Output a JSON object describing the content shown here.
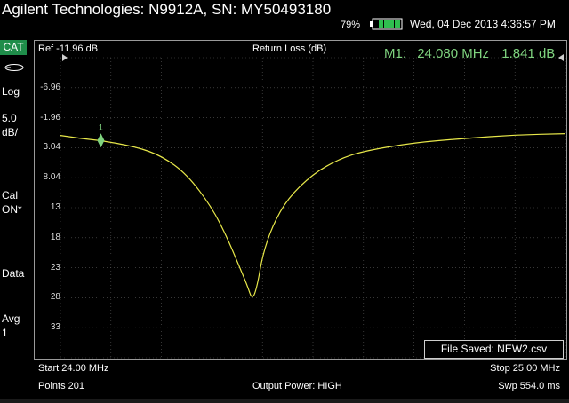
{
  "header": {
    "title": "Agilent Technologies: N9912A, SN: MY50493180",
    "battery_percent": "79%",
    "datetime": "Wed, 04 Dec 2013 4:36:57 PM"
  },
  "sidebar": {
    "mode": "CAT",
    "items": [
      {
        "label": "Log"
      },
      {
        "label": "5.0"
      },
      {
        "label": "dB/"
      },
      {
        "label": "Cal"
      },
      {
        "label": "ON*"
      },
      {
        "label": "Data"
      },
      {
        "label": "Avg"
      },
      {
        "label": "1"
      }
    ]
  },
  "plot": {
    "ref_label": "Ref -11.96 dB",
    "title": "Return Loss (dB)",
    "marker_label": "M1:",
    "marker_freq": "24.080 MHz",
    "marker_value": "1.841 dB",
    "marker_number": "1",
    "y_ticks": [
      "-6.96",
      "-1.96",
      "3.04",
      "8.04",
      "13",
      "18",
      "23",
      "28",
      "33"
    ],
    "file_status": "File Saved: NEW2.csv",
    "trace_color": "#e8e84a",
    "marker_color": "#7fd37f"
  },
  "chart_data": {
    "type": "line",
    "title": "Return Loss (dB)",
    "xlabel": "",
    "ylabel": "",
    "xlim": [
      24.0,
      25.0
    ],
    "ylim": [
      -11.96,
      38.04
    ],
    "y_inverted": true,
    "series": [
      {
        "x": [
          24.0,
          24.05,
          24.08,
          24.15,
          24.2,
          24.25,
          24.3,
          24.33,
          24.35,
          24.37,
          24.38,
          24.39,
          24.4,
          24.42,
          24.45,
          24.5,
          24.55,
          24.6,
          24.7,
          24.8,
          24.9,
          25.0
        ],
        "values": [
          1.0,
          1.6,
          1.841,
          2.9,
          4.4,
          7.4,
          13.0,
          18.0,
          22.0,
          26.0,
          28.5,
          26.0,
          21.0,
          16.0,
          11.5,
          7.4,
          5.0,
          3.6,
          2.2,
          1.5,
          0.9,
          0.7
        ]
      }
    ],
    "grid": true
  },
  "footer": {
    "start": "Start 24.00 MHz",
    "stop": "Stop 25.00 MHz",
    "points": "Points 201",
    "output_power": "Output Power: HIGH",
    "sweep": "Swp 554.0 ms"
  }
}
